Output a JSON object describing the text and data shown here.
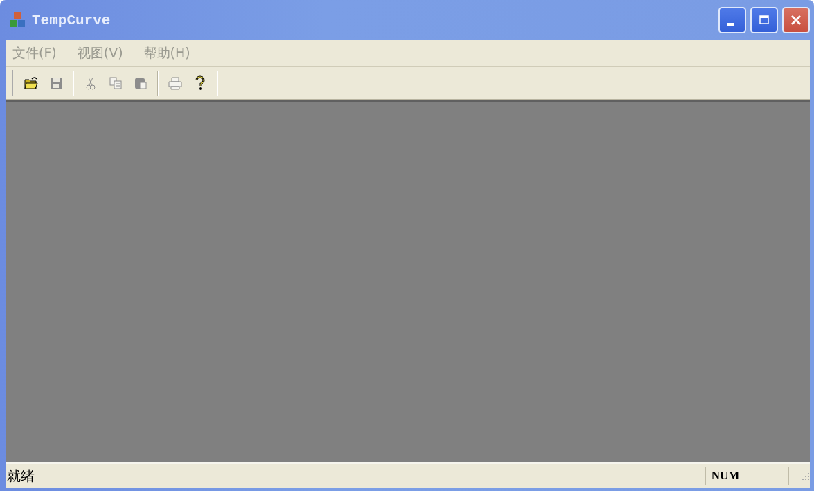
{
  "window": {
    "title": "TempCurve"
  },
  "menu": [
    {
      "label": "文件(F)",
      "disabled": true
    },
    {
      "label": "视图(V)",
      "disabled": true
    },
    {
      "label": "帮助(H)",
      "disabled": true
    }
  ],
  "toolbar": {
    "groups": [
      [
        {
          "kind": "open",
          "disabled": false
        },
        {
          "kind": "save",
          "disabled": true
        }
      ],
      [
        {
          "kind": "cut",
          "disabled": true
        },
        {
          "kind": "copy",
          "disabled": true
        },
        {
          "kind": "paste",
          "disabled": true
        }
      ],
      [
        {
          "kind": "print",
          "disabled": true
        },
        {
          "kind": "help",
          "disabled": false
        }
      ]
    ]
  },
  "status_bar": {
    "message": "就绪",
    "indicators": [
      "NUM"
    ]
  }
}
